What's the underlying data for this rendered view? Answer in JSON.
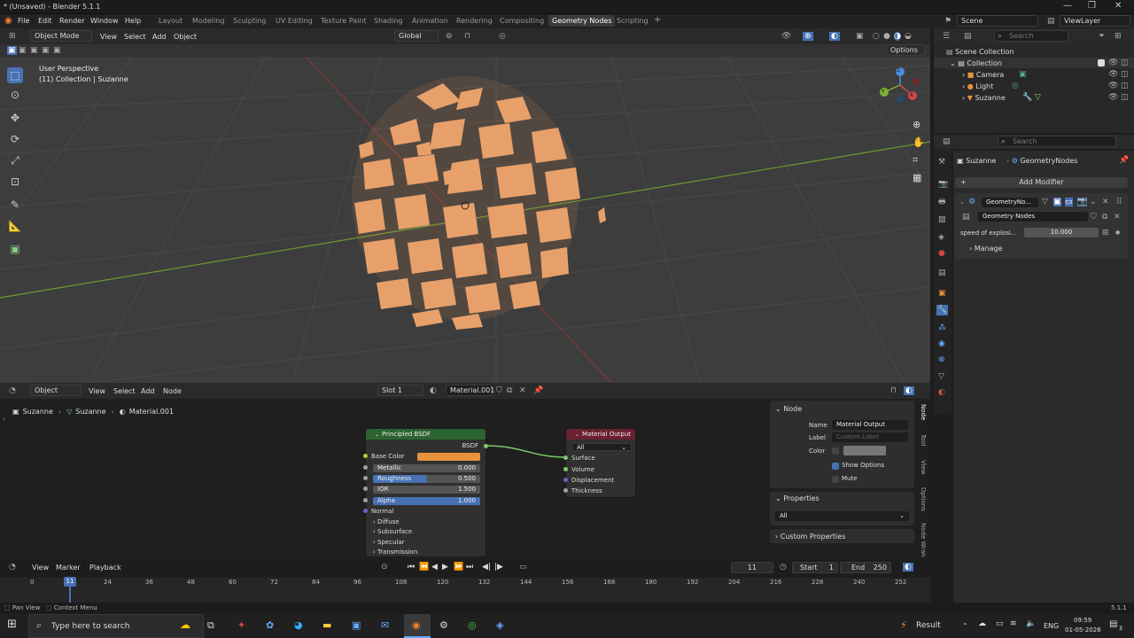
{
  "titlebar": {
    "title": "* (Unsaved) - Blender 5.1.1",
    "min": "—",
    "max": "❐",
    "close": "✕"
  },
  "menus": [
    "File",
    "Edit",
    "Render",
    "Window",
    "Help"
  ],
  "workspaces": [
    "Layout",
    "Modeling",
    "Sculpting",
    "UV Editing",
    "Texture Paint",
    "Shading",
    "Animation",
    "Rendering",
    "Compositing",
    "Geometry Nodes",
    "Scripting",
    "+"
  ],
  "scene": "Scene",
  "viewlayer": "ViewLayer",
  "viewport": {
    "mode": "Object Mode",
    "menu": [
      "View",
      "Select",
      "Add",
      "Object"
    ],
    "transform": "Global",
    "options": "Options",
    "overlay_line1": "User Perspective",
    "overlay_line2": "(11) Collection | Suzanne",
    "gizmo_x": "X",
    "gizmo_y": "Y",
    "gizmo_z": "Z"
  },
  "outliner": {
    "search": "Search",
    "root": "Scene Collection",
    "collection": "Collection",
    "items": [
      "Camera",
      "Light",
      "Suzanne"
    ]
  },
  "props": {
    "search": "Search",
    "object": "Suzanne",
    "modifier": "GeometryNodes",
    "add_modifier": "Add Modifier",
    "mod_name": "GeometryNo...",
    "nodegroup": "Geometry Nodes",
    "input_label": "speed of explosi...",
    "input_value": "10.000",
    "manage": "Manage"
  },
  "nodeeditor": {
    "type": "Object",
    "menu": [
      "View",
      "Select",
      "Add",
      "Node"
    ],
    "slot": "Slot 1",
    "material": "Material.001",
    "crumb_obj": "Suzanne",
    "crumb_mesh": "Suzanne",
    "crumb_mat": "Material.001",
    "bsdf": {
      "title": "Principled BSDF",
      "out": "BSDF",
      "base_color": "Base Color",
      "metallic": "Metallic",
      "metallic_v": "0.000",
      "roughness": "Roughness",
      "roughness_v": "0.500",
      "ior": "IOR",
      "ior_v": "1.500",
      "alpha": "Alpha",
      "alpha_v": "1.000",
      "normal": "Normal",
      "diffuse": "Diffuse",
      "subsurface": "Subsurface",
      "specular": "Specular",
      "transmission": "Transmission"
    },
    "output": {
      "title": "Material Output",
      "target": "All",
      "surface": "Surface",
      "volume": "Volume",
      "displacement": "Displacement",
      "thickness": "Thickness"
    }
  },
  "npanel": {
    "node_hdr": "Node",
    "name_label": "Name",
    "name_value": "Material Output",
    "label_label": "Label",
    "label_ph": "Custom Label",
    "color_label": "Color",
    "show_options": "Show Options",
    "mute": "Mute",
    "properties": "Properties",
    "prop_value": "All",
    "custom": "Custom Properties",
    "tabs": [
      "Node",
      "Tool",
      "View",
      "Options",
      "Node Wran"
    ]
  },
  "timeline": {
    "menu": [
      "View",
      "Marker",
      "Playback"
    ],
    "frame": "11",
    "start_label": "Start",
    "start": "1",
    "end_label": "End",
    "end": "250",
    "current": "11",
    "ticks": [
      "0",
      "24",
      "36",
      "48",
      "60",
      "72",
      "84",
      "96",
      "108",
      "120",
      "132",
      "144",
      "156",
      "168",
      "180",
      "192",
      "204",
      "216",
      "228",
      "240",
      "252"
    ]
  },
  "status": {
    "left1": "Pan View",
    "left2": "Context Menu",
    "version": "5.1.1"
  },
  "taskbar": {
    "search": "Type here to search",
    "result": "Result",
    "lang": "ENG",
    "time": "09:59",
    "date": "01-05-2026",
    "notif": "3"
  },
  "colors": {
    "accent": "#4772b3",
    "base_color": "#e8923c",
    "bsdf_header": "#2b6430",
    "output_header": "#6b2030",
    "x_axis": "#d0484a",
    "y_axis": "#7fb232"
  }
}
